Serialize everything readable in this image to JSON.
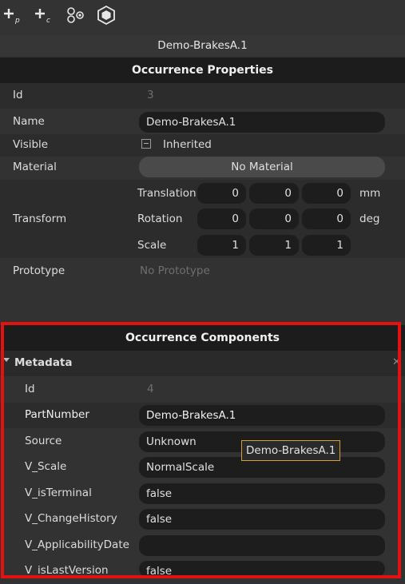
{
  "toolbar": {
    "icons": [
      "add-part-icon",
      "add-component-icon",
      "molecule-icon",
      "cube-hex-icon"
    ],
    "add_part_sub": "p",
    "add_component_sub": "c"
  },
  "title": "Demo-BrakesA.1",
  "occurrence_properties": {
    "header": "Occurrence Properties",
    "id": {
      "label": "Id",
      "value": "3"
    },
    "name": {
      "label": "Name",
      "value": "Demo-BrakesA.1"
    },
    "visible": {
      "label": "Visible",
      "value": "Inherited"
    },
    "material": {
      "label": "Material",
      "value": "No Material"
    },
    "transform": {
      "label": "Transform",
      "translation": {
        "label": "Translation",
        "values": [
          "0",
          "0",
          "0"
        ],
        "unit": "mm"
      },
      "rotation": {
        "label": "Rotation",
        "values": [
          "0",
          "0",
          "0"
        ],
        "unit": "deg"
      },
      "scale": {
        "label": "Scale",
        "values": [
          "1",
          "1",
          "1"
        ]
      }
    },
    "prototype": {
      "label": "Prototype",
      "value": "No Prototype"
    }
  },
  "occurrence_components": {
    "header": "Occurrence Components",
    "metadata": {
      "label": "Metadata",
      "id": {
        "label": "Id",
        "value": "4"
      },
      "part_number": {
        "label": "PartNumber",
        "value": "Demo-BrakesA.1"
      },
      "source": {
        "label": "Source",
        "value": "Unknown"
      },
      "v_scale": {
        "label": "V_Scale",
        "value": "NormalScale"
      },
      "v_is_terminal": {
        "label": "V_isTerminal",
        "value": "false"
      },
      "v_change_history": {
        "label": "V_ChangeHistory",
        "value": "false"
      },
      "v_applicability_date": {
        "label": "V_ApplicabilityDate",
        "value": ""
      },
      "v_is_last_version": {
        "label": "V_isLastVersion",
        "value": "false"
      }
    }
  },
  "tooltip": "Demo-BrakesA.1",
  "colors": {
    "highlight_border": "#e41111",
    "tooltip_border": "#d9a031"
  }
}
